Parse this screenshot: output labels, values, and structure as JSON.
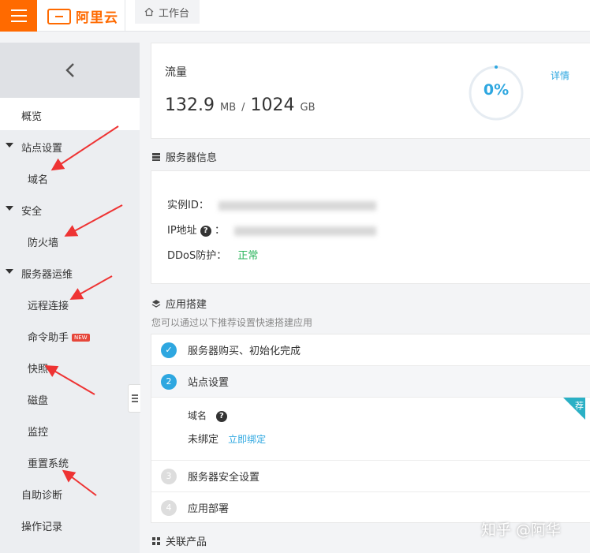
{
  "topbar": {
    "brand": "阿里云",
    "workspace_tab": "工作台"
  },
  "sidebar": {
    "items": [
      {
        "label": "概览"
      },
      {
        "label": "站点设置"
      },
      {
        "label": "域名"
      },
      {
        "label": "安全"
      },
      {
        "label": "防火墙"
      },
      {
        "label": "服务器运维"
      },
      {
        "label": "远程连接"
      },
      {
        "label": "命令助手",
        "badge": "NEW"
      },
      {
        "label": "快照"
      },
      {
        "label": "磁盘"
      },
      {
        "label": "监控"
      },
      {
        "label": "重置系统"
      },
      {
        "label": "自助诊断"
      },
      {
        "label": "操作记录"
      }
    ]
  },
  "traffic": {
    "label": "流量",
    "used": "132.9",
    "used_unit": "MB",
    "sep": "/",
    "total": "1024",
    "total_unit": "GB",
    "percent": "0%",
    "percent_value": 0,
    "detail": "详情"
  },
  "server_info": {
    "title": "服务器信息",
    "instance_label": "实例ID：",
    "instance_value": "4a...7b4305ba4c3f1a...d...",
    "ip_label": "IP地址",
    "ip_value": "(公...0.217.23...)",
    "ddos_label": "DDoS防护：",
    "ddos_value": "正常"
  },
  "app_setup": {
    "title": "应用搭建",
    "subtitle": "您可以通过以下推荐设置快速搭建应用",
    "steps": [
      {
        "num": "✓",
        "label": "服务器购买、初始化完成"
      },
      {
        "num": "2",
        "label": "站点设置"
      },
      {
        "num": "3",
        "label": "服务器安全设置"
      },
      {
        "num": "4",
        "label": "应用部署"
      }
    ],
    "domain_label": "域名",
    "domain_status": "未绑定",
    "bind_link": "立即绑定",
    "corner": "荐"
  },
  "related": {
    "title": "关联产品"
  },
  "watermark": "知乎 @阿华",
  "colors": {
    "accent": "#ff6a00",
    "link": "#2ea7e0",
    "ok": "#2bb55c"
  }
}
